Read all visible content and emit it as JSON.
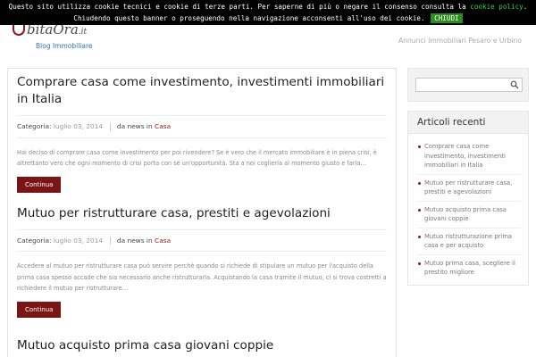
{
  "cookie_banner": {
    "text_before": "Questo sito utilizza cookie tecnici e cookie di terze parti. Per saperne di più o negare il consenso consulta la ",
    "link_label": "cookie policy",
    "text_after": ". Chiudendo questo banner o proseguendo nella navigazione acconsenti all'uso dei cookie.",
    "button_label": "CHIUDI"
  },
  "header": {
    "logo_text": "bitaOra",
    "logo_suffix": ".it",
    "tagline": "Blog Immobiliare",
    "right_text": "Annunci Immobiliari Pesaro e Urbino"
  },
  "posts": [
    {
      "title": "Comprare casa come investimento, investimenti immobiliari in Italia",
      "category_label": "Categoria:",
      "date": "luglio 03, 2014",
      "author_label": "da news in",
      "category": "Casa",
      "excerpt": "Hai deciso di comprare casa come investimento per poi rivendere? Se è vero che il mercato immobiliare è in piena crisi, è altrettanto vero che ogni momento di crisi porta con sé un'opportunità. Sta a noi coglierla al momento giusto e farla…",
      "read_more": "Continua"
    },
    {
      "title": "Mutuo per ristrutturare casa, prestiti e agevolazioni",
      "category_label": "Categoria:",
      "date": "luglio 03, 2014",
      "author_label": "da news in",
      "category": "Casa",
      "excerpt": "Accedere al mutuo per ristrutturare casa può servire perchè quando si richiede di stipulare un mutuo per l'acquisto della prima casa spesso accade che sia necessario anche ristrutturarla. Acquistando la casa tramite il mutuo, ci si trova costretti a richiedere il mutuo per ristrutturare…",
      "read_more": "Continua"
    },
    {
      "title": "Mutuo acquisto prima casa giovani coppie"
    }
  ],
  "sidebar": {
    "search_placeholder": "",
    "recent_title": "Articoli recenti",
    "recent_items": [
      "Comprare casa come investimento, investimenti immobiliari in Italia",
      "Mutuo per ristrutturare casa, prestiti e agevolazioni",
      "Mutuo acquisto prima casa giovani coppie",
      "Mutuo ristrutturazione prima casa e per acquisto",
      "Mutuo prima casa, scegliere il prestito migliore"
    ]
  },
  "colors": {
    "accent": "#7a1515",
    "cookie_link": "#2bd152",
    "cookie_button": "#2d8c1f",
    "tagline": "#3572b0"
  }
}
